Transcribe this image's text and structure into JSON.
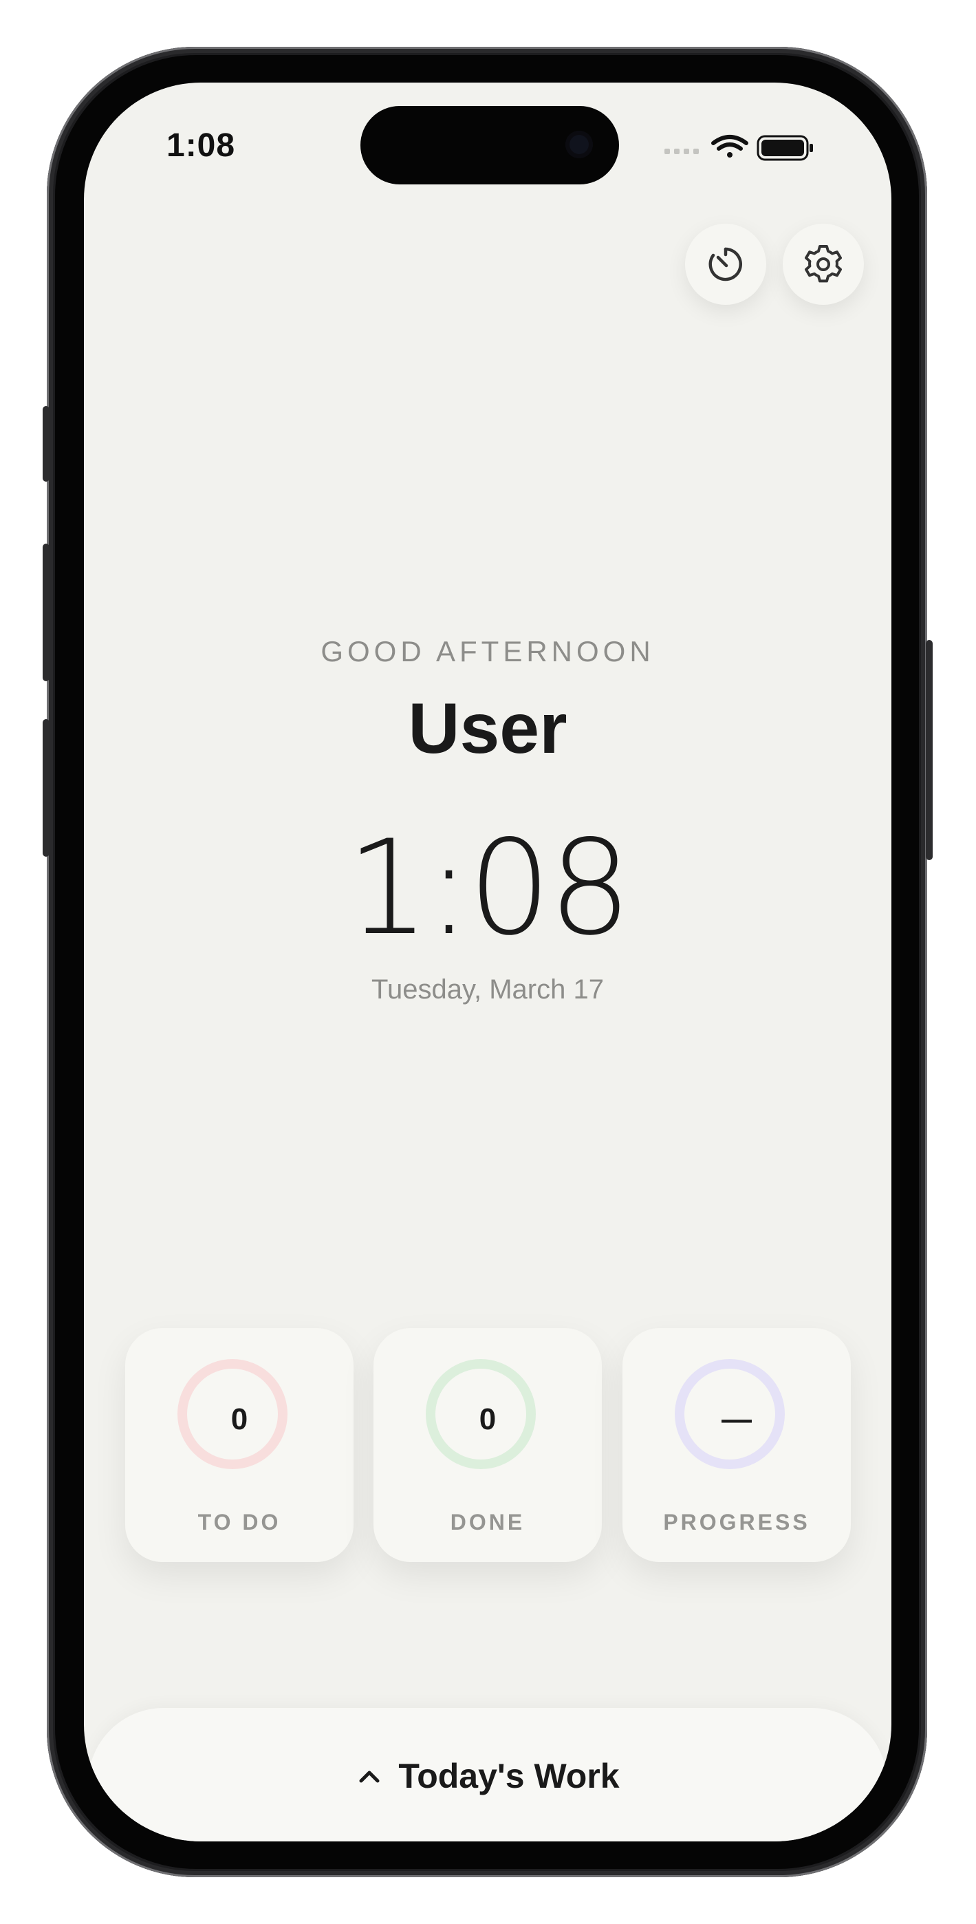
{
  "status_bar": {
    "time": "1:08"
  },
  "toolbar": {
    "timer_icon": "timer-icon",
    "settings_icon": "gear-icon"
  },
  "home": {
    "greeting": "GOOD AFTERNOON",
    "user_name": "User",
    "clock": "1:08",
    "date": "Tuesday, March 17"
  },
  "stats": [
    {
      "value": "0",
      "label": "TO DO",
      "ring_color": "#f8dedd"
    },
    {
      "value": "0",
      "label": "DONE",
      "ring_color": "#dcefdc"
    },
    {
      "value": "—",
      "label": "PROGRESS",
      "ring_color": "#e5e2f7"
    }
  ],
  "bottom_sheet": {
    "title": "Today's Work",
    "icon": "chevron-up-icon"
  },
  "colors": {
    "background": "#f2f2ee",
    "card": "#f7f7f3",
    "text_primary": "#1a1a1a",
    "text_secondary": "#8d8d8a"
  }
}
